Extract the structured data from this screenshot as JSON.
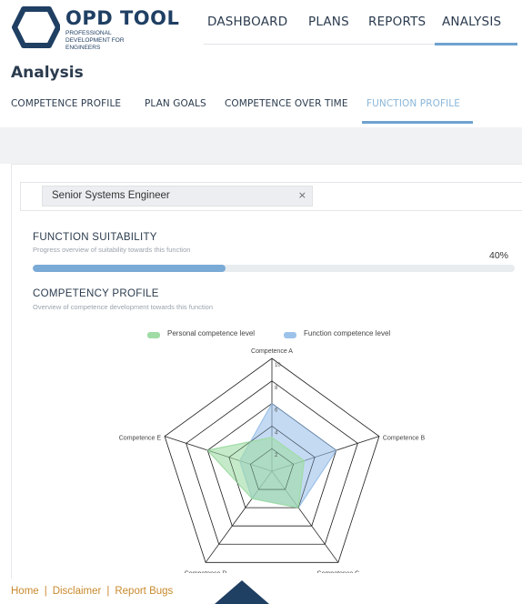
{
  "app": {
    "logo_title": "OPD TOOL",
    "logo_subtitle": "PROFESSIONAL DEVELOPMENT FOR ENGINEERS"
  },
  "nav": {
    "items": [
      {
        "label": "DASHBOARD",
        "active": false
      },
      {
        "label": "PLANS",
        "active": false
      },
      {
        "label": "REPORTS",
        "active": false
      },
      {
        "label": "ANALYSIS",
        "active": true
      }
    ]
  },
  "page": {
    "title": "Analysis"
  },
  "subtabs": [
    {
      "label": "COMPETENCE PROFILE",
      "active": false
    },
    {
      "label": "PLAN GOALS",
      "active": false
    },
    {
      "label": "COMPETENCE OVER TIME",
      "active": false
    },
    {
      "label": "FUNCTION PROFILE",
      "active": true
    }
  ],
  "function_select": {
    "selected": "Senior Systems Engineer",
    "remove_symbol": "×"
  },
  "suitability": {
    "title": "FUNCTION SUITABILITY",
    "subtitle": "Progress overview of suitability towards this function",
    "percent_label": "40%",
    "value": 0.4
  },
  "competency": {
    "title": "COMPETENCY PROFILE",
    "subtitle": "Overview of competence development towards this function"
  },
  "chart_data": {
    "type": "radar",
    "axes": [
      "Competence A",
      "Competence B",
      "Competence C",
      "Competence D",
      "Competence E"
    ],
    "r_ticks": [
      "2",
      "4",
      "6",
      "8",
      "10"
    ],
    "rmax": 10,
    "series": [
      {
        "name": "Personal competence level",
        "color": "#9fdca5",
        "values": [
          3,
          3,
          4,
          3,
          6
        ]
      },
      {
        "name": "Function competence level",
        "color": "#9dc2ea",
        "values": [
          6,
          6,
          4,
          3,
          3
        ]
      }
    ]
  },
  "footer": {
    "links": [
      "Home",
      "Disclaimer",
      "Report Bugs"
    ],
    "separator": "|"
  },
  "colors": {
    "brand_dark": "#1f3f63",
    "accent_blue": "#6fa2cf",
    "footer_link": "#c98a2e",
    "progress_fill": "#7aaad6"
  }
}
